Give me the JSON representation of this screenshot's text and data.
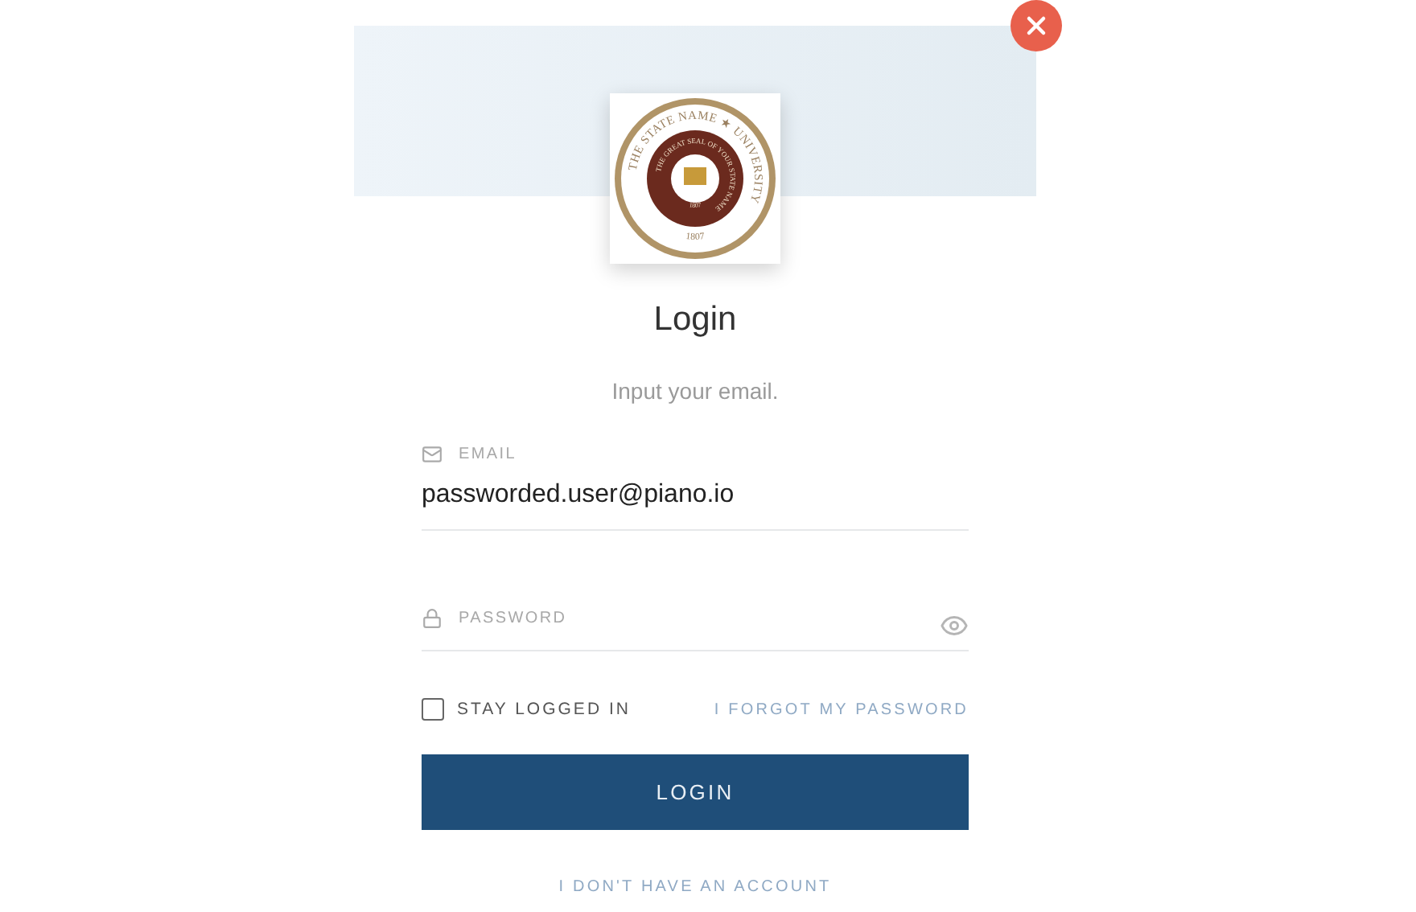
{
  "logo": {
    "outer_text": "THE STATE NAME ★ UNIVERSITY",
    "inner_text": "THE GREAT SEAL OF YOUR STATE NAME",
    "outer_year": "1807",
    "inner_year": "1807"
  },
  "title": "Login",
  "subtitle": "Input your email.",
  "email": {
    "label": "EMAIL",
    "value": "passworded.user@piano.io"
  },
  "password": {
    "label": "PASSWORD"
  },
  "stay_logged_in": {
    "label": "STAY LOGGED IN",
    "checked": false
  },
  "forgot_link": "I FORGOT MY PASSWORD",
  "login_button": "LOGIN",
  "no_account_link": "I DON'T HAVE AN ACCOUNT"
}
